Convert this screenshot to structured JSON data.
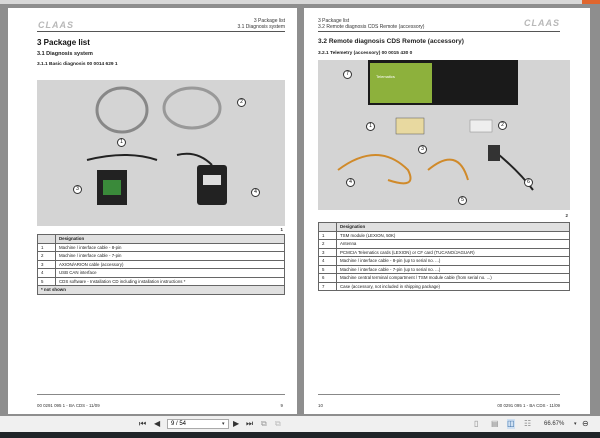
{
  "left_page": {
    "logo": "CLAAS",
    "header_line1": "3 Package list",
    "header_line2": "3.1 Diagnosis system",
    "title": "3 Package list",
    "section": "3.1 Diagnosis system",
    "subsection": "3.1.1 Basic diagnosis 00 0014 629 1",
    "figure_number": "1",
    "callouts": [
      "1",
      "2",
      "3",
      "4"
    ],
    "table": {
      "header": "Designation",
      "rows": [
        {
          "n": "1",
          "d": "Machine / interface cable - 8-pin"
        },
        {
          "n": "2",
          "d": "Machine / interface cable - 7-pin"
        },
        {
          "n": "3",
          "d": "AXION/ARION cable (accessory)"
        },
        {
          "n": "4",
          "d": "USB CAN interface"
        },
        {
          "n": "5",
          "d": "CDS software - Installation CD including installation instructions *"
        }
      ],
      "note": "* not shown"
    },
    "footer_doc": "00 0291 095 1 - BA CDS - 11/09",
    "footer_page": "9"
  },
  "right_page": {
    "logo": "CLAAS",
    "header_line1": "3 Package list",
    "header_line2": "3.2 Remote diagnosis CDS Remote (accessory)",
    "title": "3.2 Remote diagnosis CDS Remote (accessory)",
    "subsection": "3.2.1 Telemetry (accessory) 00 0015 430 0",
    "figure_number": "2",
    "callouts": [
      "7",
      "1",
      "2",
      "3",
      "4",
      "5",
      "6"
    ],
    "case_label": "Telematics",
    "table": {
      "header": "Designation",
      "rows": [
        {
          "n": "1",
          "d": "TSM module (LEXION, 50K)"
        },
        {
          "n": "2",
          "d": "Antenna"
        },
        {
          "n": "3",
          "d": "PCMCIA Telematics cards (LEXION) or CF card (TUCANO/JAGUAR)"
        },
        {
          "n": "4",
          "d": "Machine / interface cable - 8-pin (up to serial no. ...)"
        },
        {
          "n": "5",
          "d": "Machine / interface cable - 7-pin (up to serial no. ...)"
        },
        {
          "n": "6",
          "d": "Machine central terminal compartment / TSM module cable (from serial no. ...)"
        },
        {
          "n": "7",
          "d": "Case (accessory, not included in shipping package)"
        }
      ]
    },
    "footer_page": "10",
    "footer_doc": "00 0291 095 1 - BA CDS - 11/09"
  },
  "toolbar": {
    "page_value": "9 / 54",
    "zoom": "66.67%"
  }
}
